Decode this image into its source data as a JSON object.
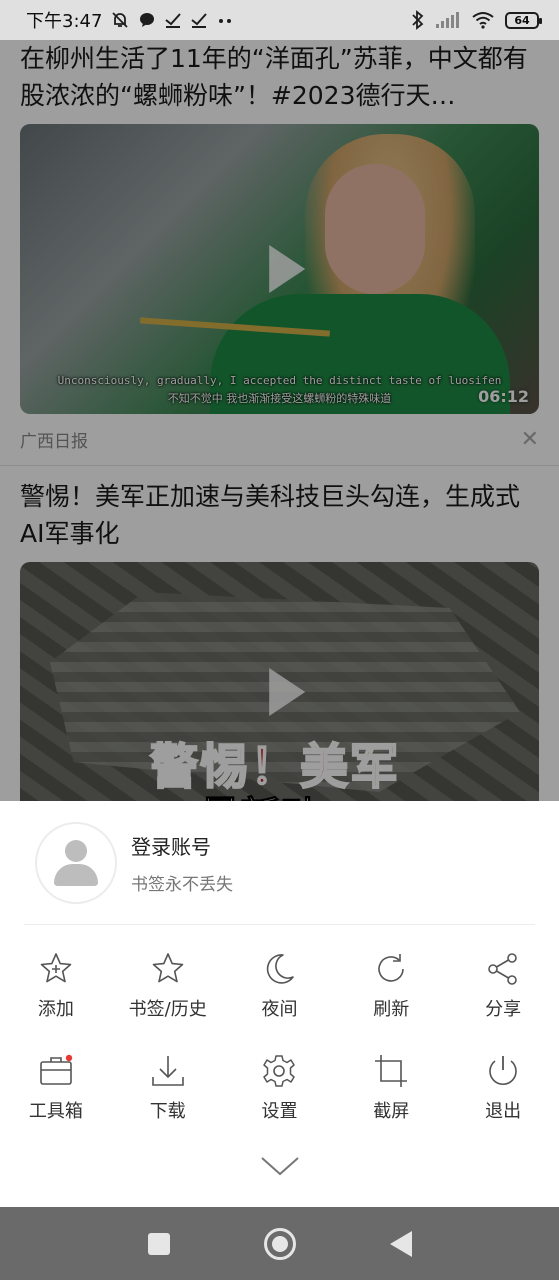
{
  "status_bar": {
    "time": "下午3:47",
    "battery": "64"
  },
  "feed": {
    "articles": [
      {
        "title": "在柳州生活了11年的“洋面孔”苏菲，中文都有股浓浓的“螺蛳粉味”！#2023德行天…",
        "subtitle_en": "Unconsciously, gradually, I accepted the distinct taste of luosifen",
        "subtitle_cn": "不知不觉中 我也渐渐接受这螺蛳粉的特殊味道",
        "duration": "06:12",
        "source": "广西日报"
      },
      {
        "title": "警惕！美军正加速与美科技巨头勾连，生成式AI军事化",
        "overlay_line1": "警惕！美军",
        "overlay_line2": "最新动"
      }
    ]
  },
  "menu": {
    "account": {
      "title": "登录账号",
      "subtitle": "书签永不丢失"
    },
    "items": [
      {
        "label": "添加",
        "icon": "star-plus-icon"
      },
      {
        "label": "书签/历史",
        "icon": "star-icon"
      },
      {
        "label": "夜间",
        "icon": "moon-icon"
      },
      {
        "label": "刷新",
        "icon": "refresh-icon"
      },
      {
        "label": "分享",
        "icon": "share-icon"
      },
      {
        "label": "工具箱",
        "icon": "toolbox-icon"
      },
      {
        "label": "下载",
        "icon": "download-icon"
      },
      {
        "label": "设置",
        "icon": "gear-icon"
      },
      {
        "label": "截屏",
        "icon": "screenshot-icon"
      },
      {
        "label": "退出",
        "icon": "power-icon"
      }
    ]
  },
  "colors": {
    "notification_dot": "#e53935",
    "icon_stroke": "#555555",
    "nav_bar": "#6a6a6a"
  }
}
